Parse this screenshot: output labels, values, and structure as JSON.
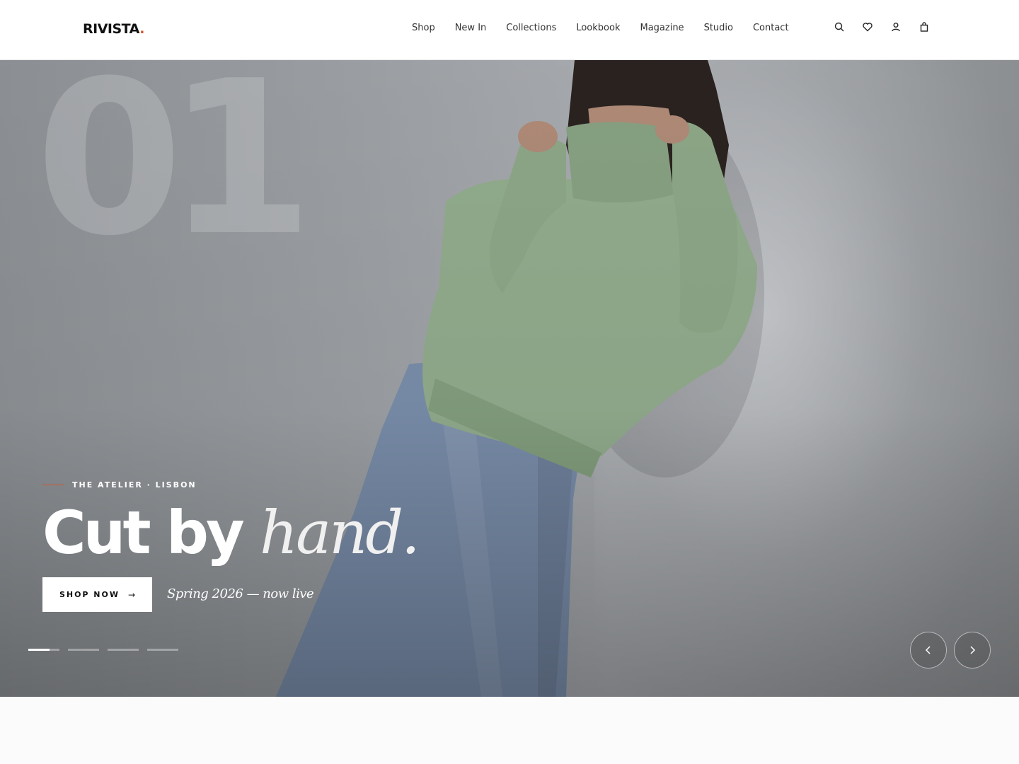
{
  "brand": {
    "name": "RIVISTA",
    "dot": ".",
    "accent_color": "#d2572f"
  },
  "nav": {
    "items": [
      {
        "label": "Shop"
      },
      {
        "label": "New In"
      },
      {
        "label": "Collections"
      },
      {
        "label": "Lookbook"
      },
      {
        "label": "Magazine"
      },
      {
        "label": "Studio"
      },
      {
        "label": "Contact"
      }
    ]
  },
  "header_icons": [
    "search-icon",
    "heart-icon",
    "user-icon",
    "bag-icon"
  ],
  "hero": {
    "slide_number": "01",
    "eyebrow": "THE ATELIER · LISBON",
    "headline_main": "Cut by ",
    "headline_italic": "hand.",
    "cta_label": "SHOP NOW",
    "cta_arrow": "→",
    "tagline": "Spring 2026 — now live",
    "slides_total": 4,
    "active_slide": 1,
    "active_progress": 0.68
  },
  "colors": {
    "hero_bg": "#9da1a5",
    "sweater": "#93ad8e",
    "jeans": "#7a8fad"
  }
}
